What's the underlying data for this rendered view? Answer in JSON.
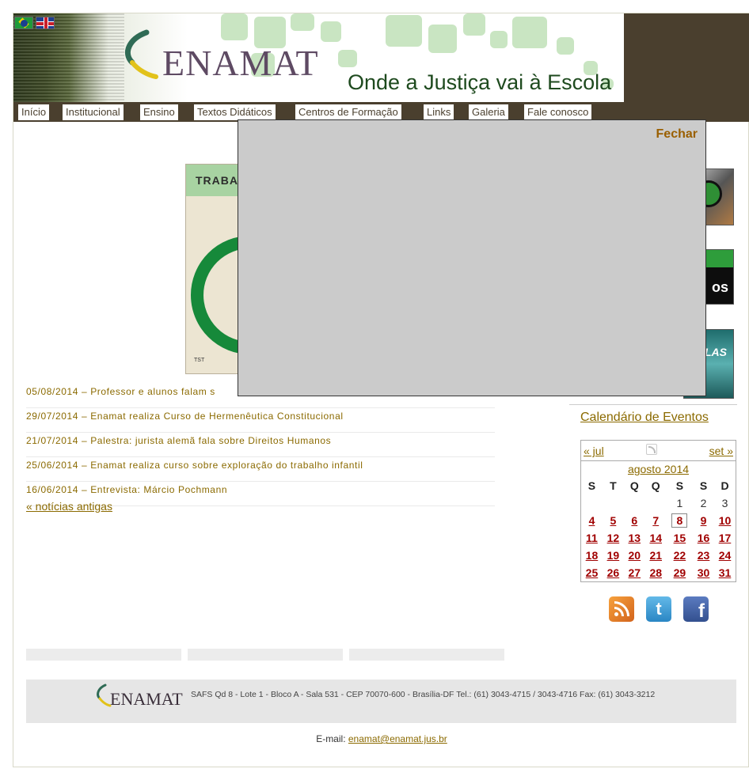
{
  "header": {
    "logo_text": "ENAMAT",
    "slogan": "Onde a Justiça vai à Escola",
    "languages": [
      "pt-BR",
      "en"
    ]
  },
  "nav": {
    "items": [
      "Início",
      "Institucional",
      "Ensino",
      "Textos Didáticos",
      "Centros de Formação",
      "Links",
      "Galeria",
      "Fale conosco"
    ]
  },
  "featured": {
    "title_fragment": "TRABA",
    "logo_text": "TST"
  },
  "news": {
    "items": [
      "05/08/2014 – Professor e alunos falam s",
      "29/07/2014 – Enamat realiza Curso de Hermenêutica Constitucional",
      "21/07/2014 – Palestra: jurista alemã fala sobre Direitos Humanos",
      "25/06/2014 – Enamat realiza curso sobre exploração do trabalho infantil",
      "16/06/2014 – Entrevista: Márcio Pochmann"
    ],
    "older_link": "« notícias antigas"
  },
  "sidebar": {
    "banner2_text": "os",
    "banner3_text": "LAS",
    "calendar_link": "Calendário de Eventos"
  },
  "calendar": {
    "prev": "« jul",
    "next": "set »",
    "month": "agosto 2014",
    "weekdays": [
      "S",
      "T",
      "Q",
      "Q",
      "S",
      "S",
      "D"
    ],
    "weeks": [
      [
        "",
        "",
        "",
        "",
        "1",
        "2",
        "3"
      ],
      [
        "4",
        "5",
        "6",
        "7",
        "8",
        "9",
        "10"
      ],
      [
        "11",
        "12",
        "13",
        "14",
        "15",
        "16",
        "17"
      ],
      [
        "18",
        "19",
        "20",
        "21",
        "22",
        "23",
        "24"
      ],
      [
        "25",
        "26",
        "27",
        "28",
        "29",
        "30",
        "31"
      ]
    ],
    "linked_days": [
      "4",
      "5",
      "6",
      "7",
      "8",
      "9",
      "10",
      "11",
      "12",
      "13",
      "14",
      "15",
      "16",
      "17",
      "18",
      "19",
      "20",
      "21",
      "22",
      "23",
      "24",
      "25",
      "26",
      "27",
      "28",
      "29",
      "30",
      "31"
    ],
    "today": "8"
  },
  "social": {
    "twitter_glyph": "t",
    "facebook_glyph": "f"
  },
  "footer": {
    "logo_text": "ENAMAT",
    "address": "SAFS Qd 8 - Lote 1 - Bloco A - Sala 531 - CEP 70070-600 - Brasília-DF Tel.: (61) 3043-4715 / 3043-4716 Fax: (61) 3043-3212",
    "email_label": "E-mail:",
    "email": "enamat@enamat.jus.br"
  },
  "modal": {
    "close_label": "Fechar"
  },
  "colors": {
    "link": "#8b6a00",
    "nav_bg": "#4a3f2e",
    "calendar_day_link": "#a00000",
    "modal_bg": "#cbcbcb"
  }
}
